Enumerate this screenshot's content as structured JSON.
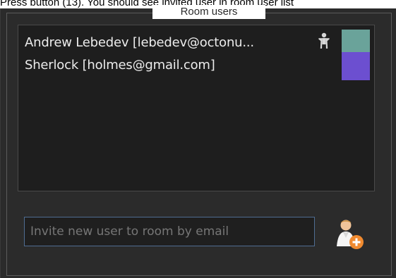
{
  "caption": {
    "text": "Press button (13). You should see invited user in room user list"
  },
  "room_users": {
    "title": "Room users",
    "users": [
      {
        "label": "Andrew Lebedev [lebedev@octonu...",
        "color": "#6aa39a",
        "has_host_icon": true
      },
      {
        "label": "Sherlock [holmes@gmail.com]",
        "color": "#6c4fd0",
        "has_host_icon": false
      }
    ]
  },
  "invite": {
    "placeholder": "Invite new user to room by email",
    "value": ""
  },
  "colors": {
    "panel": "#2b2b2b",
    "list_background": "#1e1e1e",
    "border": "#5b5b5b",
    "input_border": "#4f6d92",
    "text": "#ececec"
  },
  "icons": {
    "host": "person-icon",
    "add_user": "add-user-icon"
  }
}
